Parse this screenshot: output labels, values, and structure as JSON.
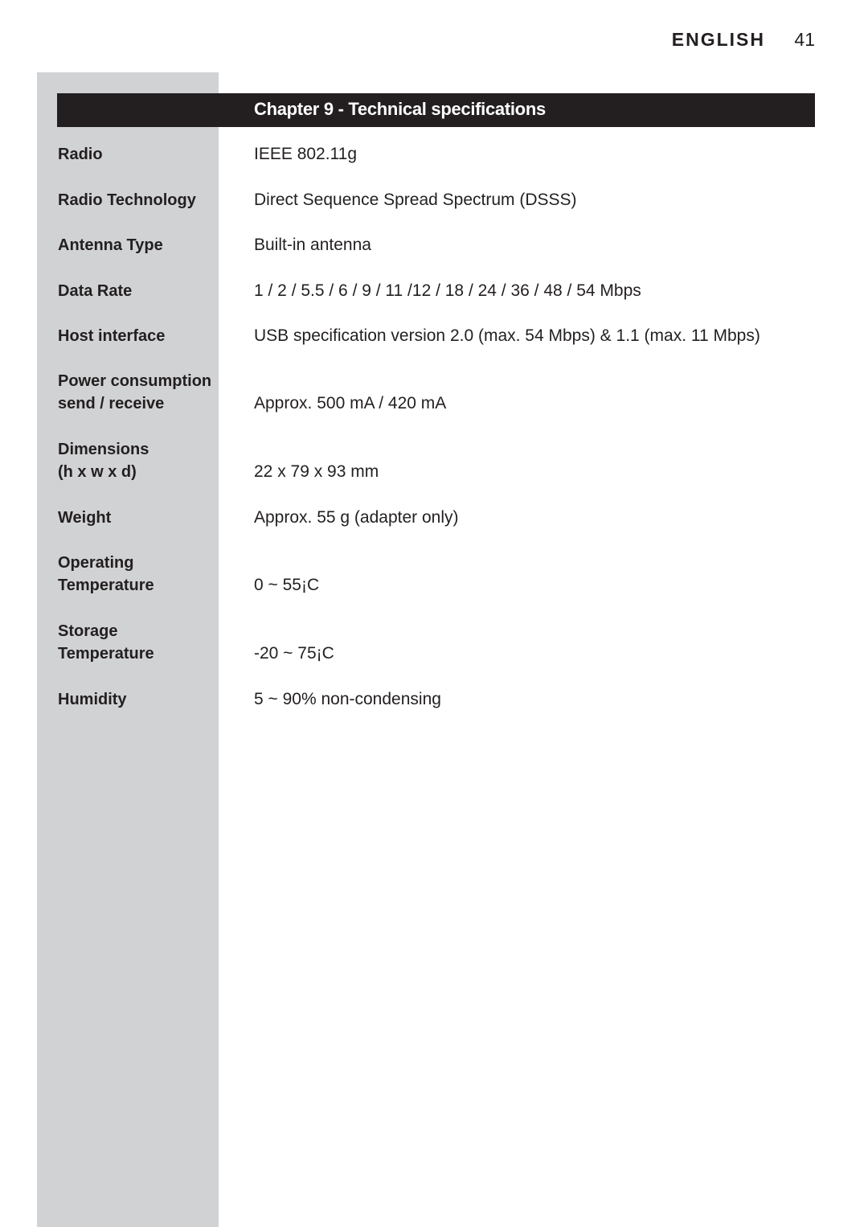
{
  "header": {
    "language": "ENGLISH",
    "page_number": "41"
  },
  "chapter_title": "Chapter 9 - Technical specifications",
  "specs": [
    {
      "label": [
        "Radio"
      ],
      "value": "IEEE 802.11g"
    },
    {
      "label": [
        "Radio Technology"
      ],
      "value": "Direct Sequence Spread Spectrum (DSSS)"
    },
    {
      "label": [
        "Antenna Type"
      ],
      "value": "Built-in antenna"
    },
    {
      "label": [
        "Data Rate"
      ],
      "value": "1 / 2 / 5.5 / 6 / 9 / 11 /12 / 18 / 24 / 36 / 48 / 54 Mbps"
    },
    {
      "label": [
        "Host interface"
      ],
      "value": "USB specification version 2.0 (max. 54 Mbps) & 1.1 (max. 11 Mbps)"
    },
    {
      "label": [
        "Power consumption",
        "send / receive"
      ],
      "value": "Approx. 500 mA / 420 mA"
    },
    {
      "label": [
        "Dimensions",
        "(h x w x d)"
      ],
      "value": "22 x 79 x 93 mm"
    },
    {
      "label": [
        "Weight"
      ],
      "value": "Approx. 55 g (adapter only)"
    },
    {
      "label": [
        "Operating",
        "Temperature"
      ],
      "value": "0 ~ 55¡C"
    },
    {
      "label": [
        "Storage",
        "Temperature"
      ],
      "value": "-20 ~ 75¡C"
    },
    {
      "label": [
        "Humidity"
      ],
      "value": "5 ~ 90% non-condensing"
    }
  ]
}
